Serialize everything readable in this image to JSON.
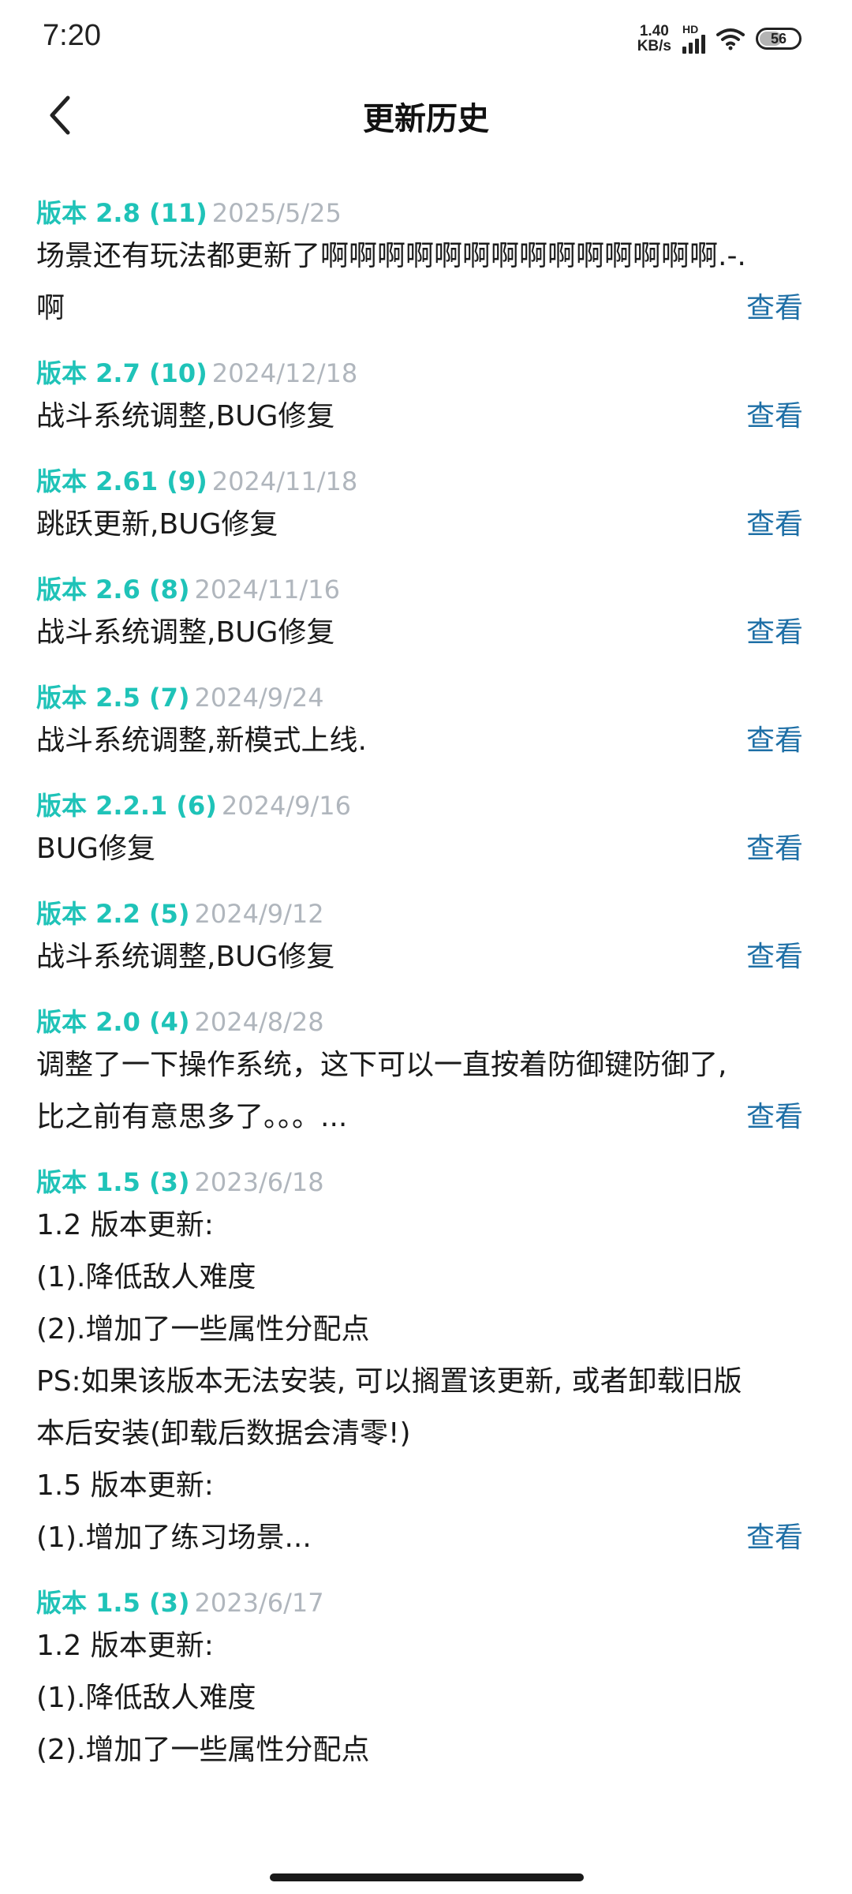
{
  "status_bar": {
    "time": "7:20",
    "net_speed_value": "1.40",
    "net_speed_unit": "KB/s",
    "signal_label": "HD",
    "battery": "56"
  },
  "header": {
    "title": "更新历史"
  },
  "entries": [
    {
      "version": "版本 2.8 (11)",
      "date": "2025/5/25",
      "lines": [
        "场景还有玩法都更新了啊啊啊啊啊啊啊啊啊啊啊啊啊啊.-.",
        "啊"
      ],
      "link": "查看"
    },
    {
      "version": "版本 2.7 (10)",
      "date": "2024/12/18",
      "lines": [
        "战斗系统调整,BUG修复"
      ],
      "link": "查看"
    },
    {
      "version": "版本 2.61 (9)",
      "date": "2024/11/18",
      "lines": [
        "跳跃更新,BUG修复"
      ],
      "link": "查看"
    },
    {
      "version": "版本 2.6 (8)",
      "date": "2024/11/16",
      "lines": [
        "战斗系统调整,BUG修复"
      ],
      "link": "查看"
    },
    {
      "version": "版本 2.5 (7)",
      "date": "2024/9/24",
      "lines": [
        "战斗系统调整,新模式上线."
      ],
      "link": "查看"
    },
    {
      "version": "版本 2.2.1 (6)",
      "date": "2024/9/16",
      "lines": [
        "BUG修复"
      ],
      "link": "查看"
    },
    {
      "version": "版本 2.2 (5)",
      "date": "2024/9/12",
      "lines": [
        "战斗系统调整,BUG修复"
      ],
      "link": "查看"
    },
    {
      "version": "版本 2.0 (4)",
      "date": "2024/8/28",
      "lines": [
        "调整了一下操作系统，这下可以一直按着防御键防御了,",
        "比之前有意思多了。。。..."
      ],
      "link": "查看"
    },
    {
      "version": "版本 1.5 (3)",
      "date": "2023/6/18",
      "lines": [
        "1.2 版本更新:",
        "(1).降低敌人难度",
        "(2).增加了一些属性分配点",
        "PS:如果该版本无法安装, 可以搁置该更新, 或者卸载旧版",
        "本后安装(卸载后数据会清零!)",
        "1.5 版本更新:",
        "(1).增加了练习场景..."
      ],
      "link": "查看"
    },
    {
      "version": "版本 1.5 (3)",
      "date": "2023/6/17",
      "lines": [
        "1.2 版本更新:",
        "(1).降低敌人难度",
        "(2).增加了一些属性分配点"
      ],
      "link": ""
    }
  ]
}
